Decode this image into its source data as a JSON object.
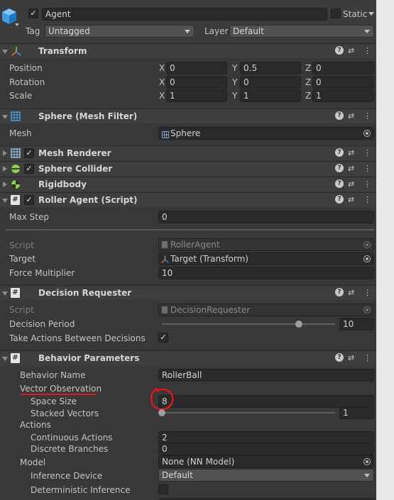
{
  "go": {
    "name": "Agent",
    "static_label": "Static",
    "tag_label": "Tag",
    "tag_value": "Untagged",
    "layer_label": "Layer",
    "layer_value": "Default"
  },
  "transform": {
    "title": "Transform",
    "position": {
      "label": "Position",
      "x": "0",
      "y": "0.5",
      "z": "0"
    },
    "rotation": {
      "label": "Rotation",
      "x": "0",
      "y": "0",
      "z": "0"
    },
    "scale": {
      "label": "Scale",
      "x": "1",
      "y": "1",
      "z": "1"
    },
    "axes": {
      "x": "X",
      "y": "Y",
      "z": "Z"
    }
  },
  "mesh_filter": {
    "title": "Sphere (Mesh Filter)",
    "mesh_label": "Mesh",
    "mesh_value": "Sphere"
  },
  "mesh_renderer": {
    "title": "Mesh Renderer"
  },
  "sphere_collider": {
    "title": "Sphere Collider"
  },
  "rigidbody": {
    "title": "Rigidbody"
  },
  "roller_agent": {
    "title": "Roller Agent (Script)",
    "max_step_label": "Max Step",
    "max_step_value": "0",
    "script_label": "Script",
    "script_value": "RollerAgent",
    "target_label": "Target",
    "target_value": "Target (Transform)",
    "force_label": "Force Multiplier",
    "force_value": "10"
  },
  "decision_requester": {
    "title": "Decision Requester",
    "script_label": "Script",
    "script_value": "DecisionRequester",
    "period_label": "Decision Period",
    "period_value": "10",
    "period_fraction": 0.79,
    "take_actions_label": "Take Actions Between Decisions",
    "take_actions_checked": true
  },
  "behavior": {
    "title": "Behavior Parameters",
    "name_label": "Behavior Name",
    "name_value": "RollerBall",
    "vector_obs_label": "Vector Observation",
    "space_size_label": "Space Size",
    "space_size_value": "8",
    "stacked_label": "Stacked Vectors",
    "stacked_value": "1",
    "stacked_fraction": 0.0,
    "actions_label": "Actions",
    "continuous_label": "Continuous Actions",
    "continuous_value": "2",
    "discrete_label": "Discrete Branches",
    "discrete_value": "0",
    "model_label": "Model",
    "model_value": "None (NN Model)",
    "inference_label": "Inference Device",
    "inference_value": "Default",
    "deterministic_label": "Deterministic Inference",
    "deterministic_checked": false
  },
  "glyphs": {
    "check": "✓",
    "help": "?",
    "settings": "⇄",
    "more": "⋮",
    "hash": "#"
  },
  "colors": {
    "annotation_red": "#e0191e",
    "header_bg": "#3e3e3e",
    "panel_bg": "#383838"
  }
}
